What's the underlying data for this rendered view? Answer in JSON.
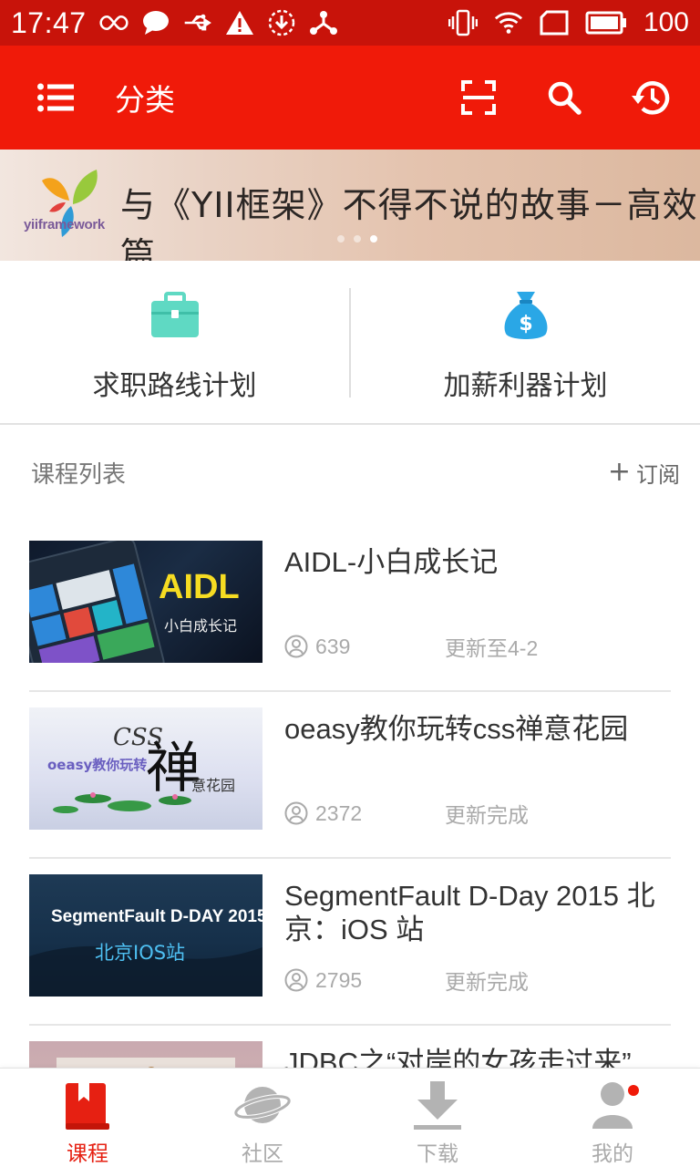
{
  "status_bar": {
    "time": "17:47",
    "battery": "100",
    "icons": [
      "infinity-icon",
      "message-icon",
      "usb-icon",
      "warning-icon",
      "download-icon",
      "share-icon",
      "vibrate-icon",
      "wifi-icon",
      "sim-icon",
      "battery-icon"
    ]
  },
  "toolbar": {
    "title": "分类",
    "icons": [
      "menu-icon",
      "scan-icon",
      "search-icon",
      "history-icon"
    ],
    "accent": "#f01a09"
  },
  "banner": {
    "logo_text": "yiiframework",
    "title": "与《YII框架》不得不说的故事－高效篇",
    "page_count": 3,
    "active_page": 3
  },
  "plans": [
    {
      "label": "求职路线计划",
      "icon": "briefcase-icon",
      "color": "#5fd9c3"
    },
    {
      "label": "加薪利器计划",
      "icon": "money-bag-icon",
      "color": "#2aa7e6"
    }
  ],
  "course_section": {
    "title": "课程列表",
    "subscribe_label": "订阅"
  },
  "courses": [
    {
      "title": "AIDL-小白成长记",
      "learners": "639",
      "status": "更新至4-2",
      "thumb_text": "AIDL",
      "thumb_sub": "小白成长记"
    },
    {
      "title": "oeasy教你玩转css禅意花园",
      "learners": "2372",
      "status": "更新完成",
      "thumb_text": "CSS",
      "thumb_sub": "oeasy教你玩转",
      "thumb_char": "禅",
      "thumb_sub2": "意花园"
    },
    {
      "title": "SegmentFault D-Day 2015 北京：iOS 站",
      "learners": "2795",
      "status": "更新完成",
      "thumb_text": "SegmentFault D-DAY 2015",
      "thumb_sub": "北京IOS站"
    },
    {
      "title": "JDBC之“对岸的女孩走过来”",
      "learners": "",
      "status": ""
    }
  ],
  "bottom_nav": [
    {
      "label": "课程",
      "icon": "book-icon",
      "active": true
    },
    {
      "label": "社区",
      "icon": "planet-icon",
      "active": false
    },
    {
      "label": "下载",
      "icon": "download-tray-icon",
      "active": false
    },
    {
      "label": "我的",
      "icon": "profile-icon",
      "active": false,
      "badge": true
    }
  ]
}
